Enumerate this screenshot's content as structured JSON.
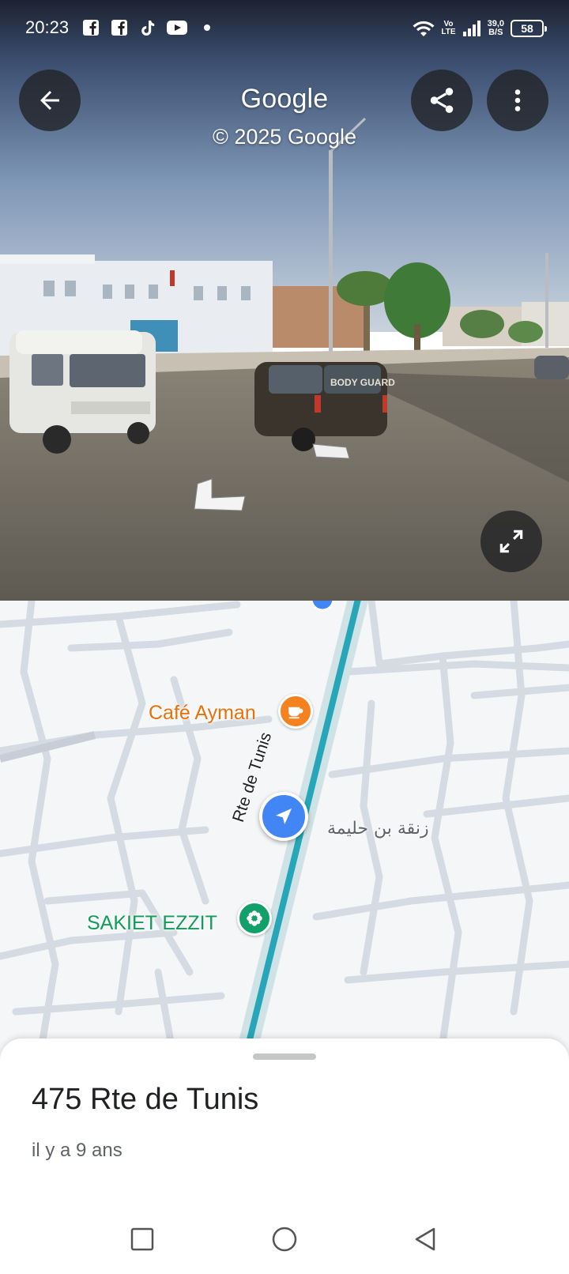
{
  "status_bar": {
    "time": "20:23",
    "apps": [
      "facebook-icon",
      "facebook-icon",
      "tiktok-icon",
      "youtube-icon"
    ],
    "volte_top": "Vo",
    "volte_bottom": "LTE",
    "speed_value": "39,0",
    "speed_unit": "B/S",
    "battery": "58"
  },
  "street_view": {
    "title": "Google",
    "copyright": "© 2025 Google",
    "van_text": "BODY GUARD"
  },
  "map": {
    "cafe_label": "Café Ayman",
    "street_label_arabic": "زنقة بن حليمة",
    "road_label": "Rte de Tunis",
    "place_label": "SAKIET EZZIT",
    "road_color": "#26a6b8"
  },
  "sheet": {
    "title": "475 Rte de Tunis",
    "subtitle": "il y a 9 ans"
  },
  "colors": {
    "accent_blue": "#4285f4",
    "cafe_orange": "#e8710a",
    "place_green": "#0f9d58"
  }
}
